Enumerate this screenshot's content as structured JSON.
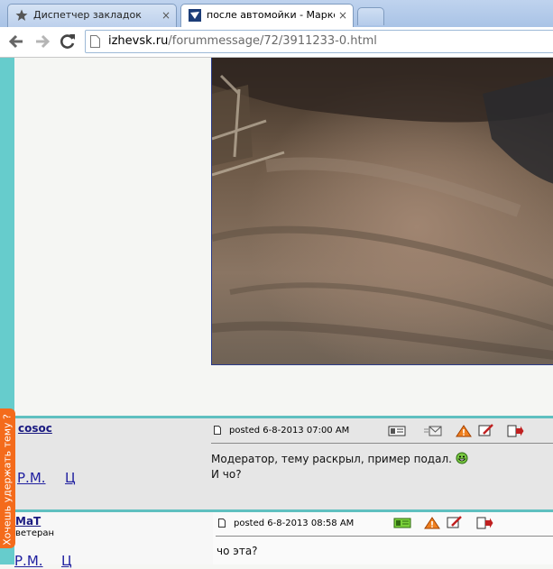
{
  "browser": {
    "tabs": [
      {
        "title": "Диспетчер закладок",
        "icon": "star-icon",
        "close": "×"
      },
      {
        "title": "после автомойки - Марковс",
        "icon": "site-icon",
        "close": "×"
      }
    ],
    "url": {
      "host": "izhevsk.ru",
      "path": "/forummessage/72/3911233-0.html"
    }
  },
  "side_tab": {
    "label": "Хочешь удержать тему ?",
    "color": "#f46b1b"
  },
  "posts": [
    {
      "author": "cosoc",
      "links": [
        "Р.М.",
        "Ц"
      ],
      "posted": "posted 6-8-2013 07:00 AM",
      "message": [
        "Модератор, тему раскрыл, пример подал.",
        "И чо?"
      ]
    },
    {
      "author": "MaT",
      "rank": "ветеран",
      "links": [
        "Р.М.",
        "Ц"
      ],
      "posted": "posted 6-8-2013 08:58 AM",
      "message": [
        "чо эта?"
      ]
    }
  ],
  "colors": {
    "accent": "#66cccc",
    "link": "#2020a0"
  }
}
